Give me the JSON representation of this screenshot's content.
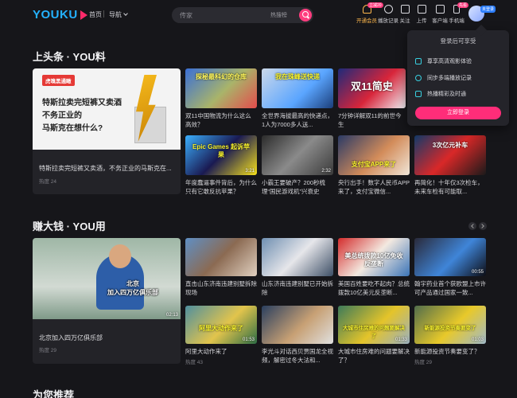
{
  "nav": {
    "logo": "YOUKU",
    "home": "首页",
    "guide": "导航",
    "search_placeholder": "传家",
    "hot_search": "热搜榜"
  },
  "tools": [
    {
      "label": "开通会员",
      "badge": "立减20"
    },
    {
      "label": "播放记录",
      "badge": ""
    },
    {
      "label": "关注",
      "badge": ""
    },
    {
      "label": "上传",
      "badge": ""
    },
    {
      "label": "客户端",
      "badge": ""
    },
    {
      "label": "手机端",
      "badge": "先看"
    }
  ],
  "avatar_tag": "未登录",
  "popover": {
    "title": "登录后可享受",
    "items": [
      "尊享高清观影体验",
      "同步多端播放记录",
      "热播精彩及时通"
    ],
    "button": "立即登录"
  },
  "section1": {
    "title": "上头条 · YOU料",
    "feature": {
      "brand": "虎嗅黑通瞰",
      "headline": [
        "特斯拉卖完短裤又卖酒",
        "不务正业的",
        "马斯克在想什么?"
      ],
      "title": "特斯拉卖完短裤又卖酒，不务正业的马斯克在...",
      "heat": "热度 24"
    },
    "cards": [
      {
        "overlay": "探秘最科幻的仓库",
        "title": "双11中国物流为什么这么高效？",
        "dur": ""
      },
      {
        "overlay": "我在珠峰送快递",
        "title": "全世界海拔最高的快递点，1人为7000多人送...",
        "dur": ""
      },
      {
        "overlay": "双11简史",
        "title": "7分钟详解双11的前世今生",
        "dur": ""
      },
      {
        "overlay": "Epic Games 起诉苹果",
        "title": "年度蠢逼事件背后，为什么只有它敢反抗苹果？",
        "dur": "3:21"
      },
      {
        "overlay": "",
        "title": "小霸王要破产？200秒梳理“国民游戏机”兴衰史",
        "dur": "2:32"
      },
      {
        "overlay": "支付宝APP来了",
        "title": "央行出手！数字人民币APP来了，支付宝微信...",
        "dur": ""
      },
      {
        "overlay": "3次亿元补车",
        "title": "再简化！十年仅3次检车，未来车检有可能取...",
        "dur": ""
      }
    ]
  },
  "section2": {
    "title": "赚大钱 · YOU用",
    "feature": {
      "caption": [
        "北京",
        "加入四万亿俱乐部"
      ],
      "duration": "02:13",
      "title": "北京加入四万亿俱乐部",
      "heat": "热度 29"
    },
    "cards": [
      {
        "overlay": "",
        "title": "直击山东济南违建别墅拆除现场",
        "dur": ""
      },
      {
        "overlay": "",
        "title": "山东济南违建别墅已开始拆除",
        "dur": ""
      },
      {
        "overlay": "美总统拨款10亿免收反垄断",
        "title": "美国百姓要吃不起肉？总统拨款10亿美元反垄断...",
        "dur": ""
      },
      {
        "overlay": "",
        "title": "翰宇药业首个获欧盟上市许可产品通过国家一致...",
        "dur": "00:55"
      },
      {
        "overlay": "阿里大动作来了",
        "title": "阿里大动作来了",
        "dur": "01:53",
        "heat": "热度 43"
      },
      {
        "overlay": "",
        "title": "李光斗对话西贝贾国龙全视频，解密过冬大法和...",
        "dur": ""
      },
      {
        "overlay": "大城市住房难的问题要解决了",
        "title": "大城市住房难的问题要解决了？",
        "dur": "01:33"
      },
      {
        "overlay": "新能源投资节奏要变了",
        "title": "新能源投资节奏要变了？",
        "dur": "01:03",
        "heat": "热度 29"
      }
    ]
  },
  "section3": {
    "title": "为您推荐"
  }
}
